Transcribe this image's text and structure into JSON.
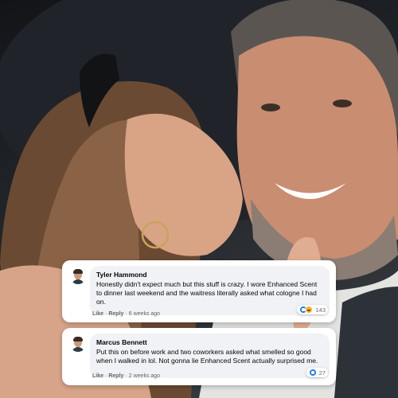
{
  "comments": [
    {
      "author": "Tyler Hammond",
      "text": "Honestly didn't expect much but this stuff is crazy. I wore Enhanced Scent to dinner last weekend and the waitress literally asked what cologne I had on.",
      "actions": {
        "like": "Like",
        "reply": "Reply"
      },
      "time": "6 weeks ago",
      "reactions": [
        "like",
        "haha"
      ],
      "reaction_count": "143"
    },
    {
      "author": "Marcus Bennett",
      "text": "Put this on before work and two coworkers asked what smelled so good when I walked in lol. Not gonna lie Enhanced Scent actually surprised me.",
      "actions": {
        "like": "Like",
        "reply": "Reply"
      },
      "time": "2 weeks ago",
      "reactions": [
        "like"
      ],
      "reaction_count": "27"
    }
  ],
  "colors": {
    "like_blue": "#1877f2",
    "haha_yellow": "#f7b125",
    "bubble_bg": "#f0f2f5",
    "meta_gray": "#65676b"
  }
}
